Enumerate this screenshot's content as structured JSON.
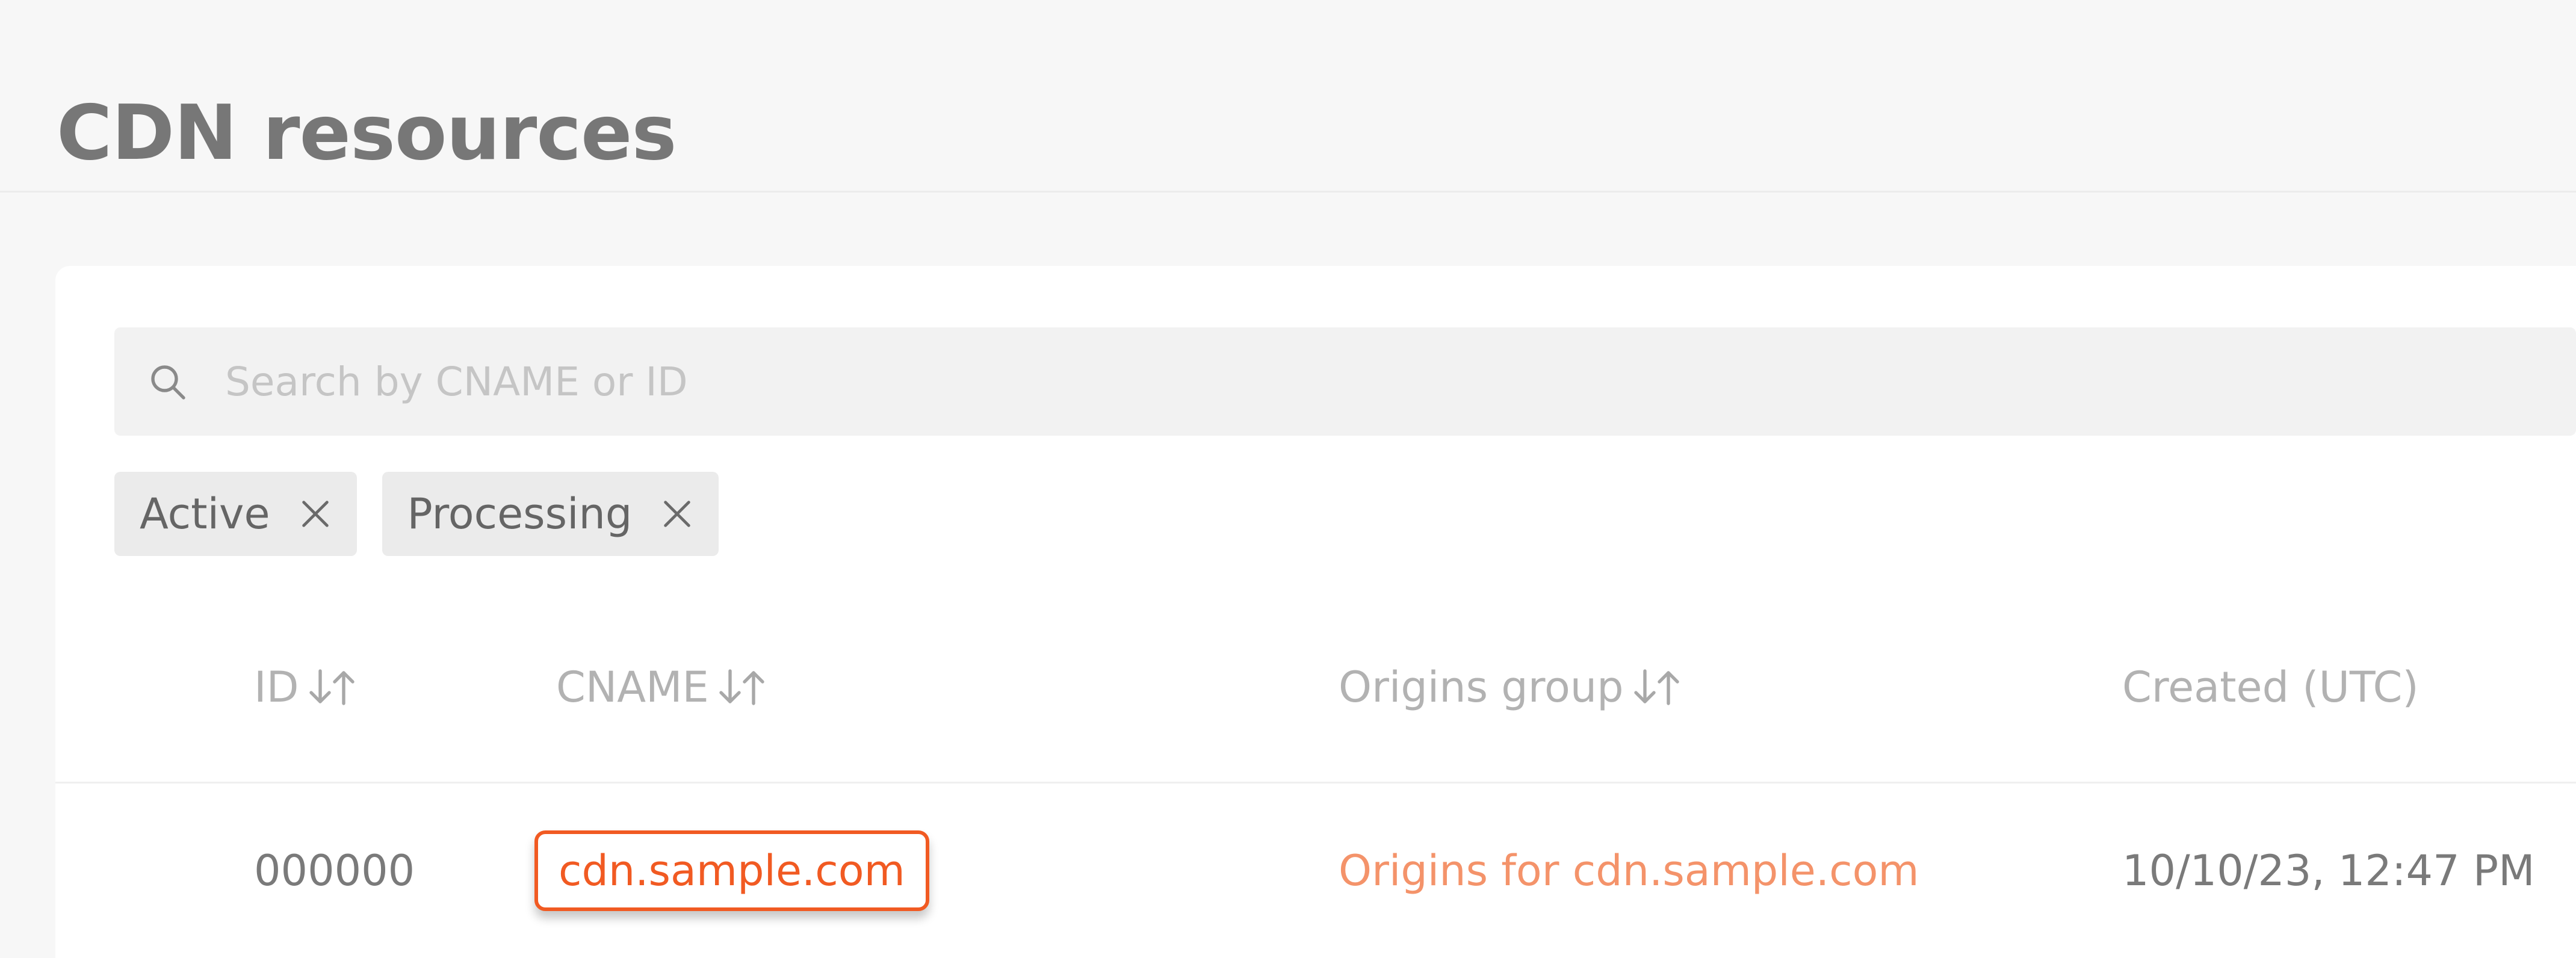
{
  "header": {
    "title": "CDN resources"
  },
  "search": {
    "placeholder": "Search by CNAME or ID",
    "value": "",
    "icon": "search-icon"
  },
  "filters": {
    "chips": [
      {
        "label": "Active",
        "close_icon": "close-icon"
      },
      {
        "label": "Processing",
        "close_icon": "close-icon"
      }
    ]
  },
  "table": {
    "columns": [
      {
        "label": "ID",
        "sortable": true,
        "sort_icon": "sort-icon"
      },
      {
        "label": "CNAME",
        "sortable": true,
        "sort_icon": "sort-icon"
      },
      {
        "label": "Origins group",
        "sortable": true,
        "sort_icon": "sort-icon"
      },
      {
        "label": "Created (UTC)",
        "sortable": false
      }
    ],
    "rows": [
      {
        "id": "000000",
        "cname": "cdn.sample.com",
        "origins_group": "Origins for cdn.sample.com",
        "created": "10/10/23, 12:47 PM"
      }
    ]
  },
  "colors": {
    "accent": "#f15a22",
    "link_muted": "#f4936a",
    "page_background": "#f7f7f7",
    "card_background": "#ffffff",
    "chip_background": "#ebebeb",
    "search_background": "#f2f2f2",
    "title_text": "#777777",
    "header_text": "#b2b2b2"
  }
}
